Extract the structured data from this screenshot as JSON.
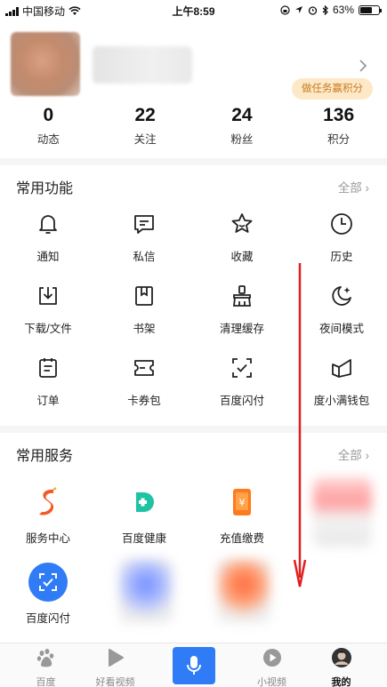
{
  "status_bar": {
    "carrier": "中国移动",
    "time": "上午8:59",
    "battery": "63%",
    "battery_level": 0.63
  },
  "profile": {
    "task_badge": "做任务赢积分",
    "stats": [
      {
        "value": "0",
        "label": "动态"
      },
      {
        "value": "22",
        "label": "关注"
      },
      {
        "value": "24",
        "label": "粉丝"
      },
      {
        "value": "136",
        "label": "积分"
      }
    ]
  },
  "common_functions": {
    "title": "常用功能",
    "all_label": "全部",
    "items": [
      {
        "label": "通知",
        "icon": "bell-icon"
      },
      {
        "label": "私信",
        "icon": "message-icon"
      },
      {
        "label": "收藏",
        "icon": "star-icon"
      },
      {
        "label": "历史",
        "icon": "clock-icon"
      },
      {
        "label": "下载/文件",
        "icon": "download-icon"
      },
      {
        "label": "书架",
        "icon": "bookmark-icon"
      },
      {
        "label": "清理缓存",
        "icon": "broom-icon"
      },
      {
        "label": "夜间模式",
        "icon": "moon-icon"
      },
      {
        "label": "订单",
        "icon": "order-icon"
      },
      {
        "label": "卡券包",
        "icon": "coupon-icon"
      },
      {
        "label": "百度闪付",
        "icon": "scan-check-icon"
      },
      {
        "label": "度小满钱包",
        "icon": "wallet-icon"
      }
    ]
  },
  "common_services": {
    "title": "常用服务",
    "all_label": "全部",
    "items": [
      {
        "label": "服务中心",
        "icon": "service-center-icon"
      },
      {
        "label": "百度健康",
        "icon": "health-icon"
      },
      {
        "label": "充值缴费",
        "icon": "recharge-icon"
      },
      {
        "label": "百度闪付",
        "icon": "scan-pay-icon"
      }
    ]
  },
  "tabbar": {
    "tabs": [
      {
        "label": "百度",
        "icon": "baidu-paw-icon"
      },
      {
        "label": "好看视频",
        "icon": "play-icon"
      },
      {
        "label": "",
        "icon": "microphone-icon"
      },
      {
        "label": "小视频",
        "icon": "small-video-icon"
      },
      {
        "label": "我的",
        "icon": "user-avatar-icon"
      }
    ]
  },
  "colors": {
    "accent_blue": "#2f7cf6",
    "badge_text": "#c9791c",
    "badge_bg": "#fde9c8",
    "annotation_red": "#e02020"
  }
}
